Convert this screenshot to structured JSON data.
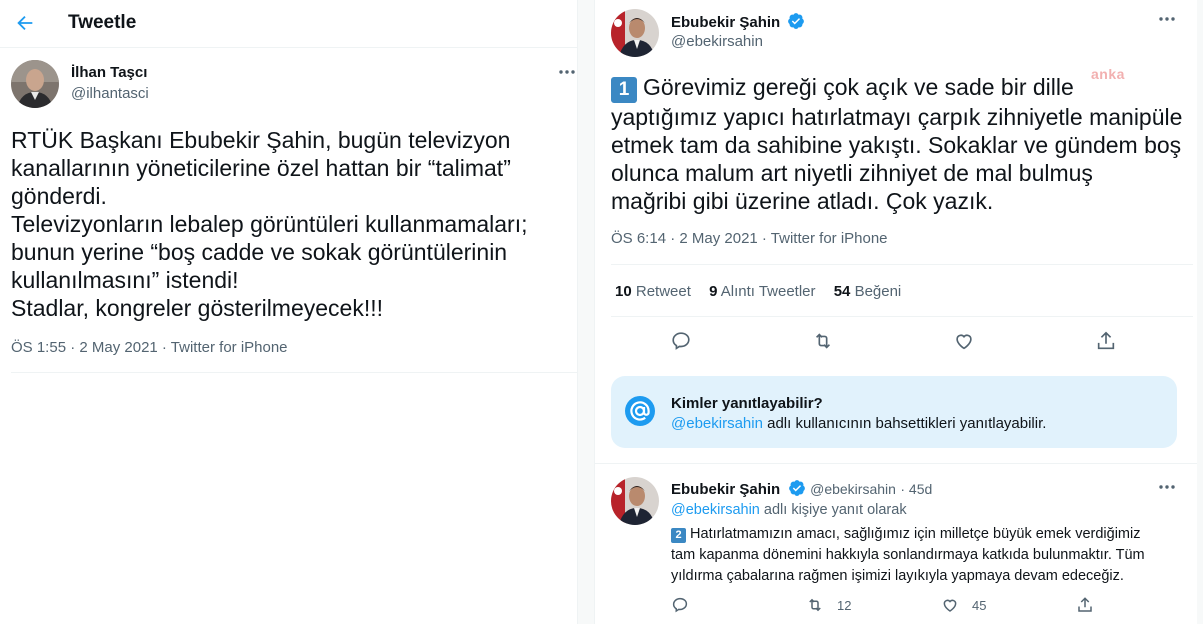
{
  "left": {
    "header_title": "Tweetle",
    "author_name": "İlhan Taşcı",
    "author_handle": "@ilhantasci",
    "tweet_lines": [
      "RTÜK Başkanı Ebubekir Şahin, bugün televizyon",
      "kanallarının yöneticilerine özel hattan bir “talimat”",
      "gönderdi.",
      "Televizyonların lebalep görüntüleri kullanmamaları;",
      "bunun yerine “boş cadde ve sokak görüntülerinin",
      "kullanılmasını” istendi!",
      "Stadlar, kongreler gösterilmeyecek!!!"
    ],
    "meta": "ÖS 1:55 · 2 May 2021 · Twitter for iPhone"
  },
  "right": {
    "author_name": "Ebubekir Şahin",
    "author_handle": "@ebekirsahin",
    "badge_number": "1",
    "tweet_lines": [
      "Görevimiz gereği çok açık ve sade bir dille",
      "yaptığımız yapıcı hatırlatmayı çarpık zihniyetle manipüle",
      "etmek tam da sahibine yakıştı. Sokaklar ve gündem boş",
      "olunca malum art niyetli zihniyet de mal bulmuş",
      "mağribi gibi üzerine atladı. Çok yazık."
    ],
    "watermark": "anka",
    "meta": "ÖS 6:14 · 2 May 2021 · Twitter for iPhone",
    "stats": {
      "retweet_count": "10",
      "retweet_label": "Retweet",
      "quote_count": "9",
      "quote_label": "Alıntı Tweetler",
      "like_count": "54",
      "like_label": "Beğeni"
    },
    "reply_box": {
      "title": "Kimler yanıtlayabilir?",
      "mention": "@ebekirsahin",
      "body": " adlı kullanıcının bahsettikleri yanıtlayabilir."
    },
    "reply": {
      "author_name": "Ebubekir Şahin",
      "author_handle": "@ebekirsahin",
      "time": "· 45d",
      "replying_to": "@ebekirsahin",
      "replying_suffix": " adlı kişiye yanıt olarak",
      "badge_number": "2",
      "text_lines": [
        "Hatırlatmamızın amacı, sağlığımız için milletçe büyük emek verdiğimiz",
        "tam kapanma dönemini hakkıyla sonlandırmaya katkıda bulunmaktır. Tüm",
        "yıldırma çabalarına rağmen işimizi layıkıyla yapmaya devam edeceğiz."
      ],
      "retweet_count": "12",
      "like_count": "45"
    }
  },
  "colors": {
    "accent": "#1d9bf0",
    "secondary_text": "#536471",
    "divider": "#eff3f4",
    "reply_box_bg": "#e1f2fc"
  }
}
